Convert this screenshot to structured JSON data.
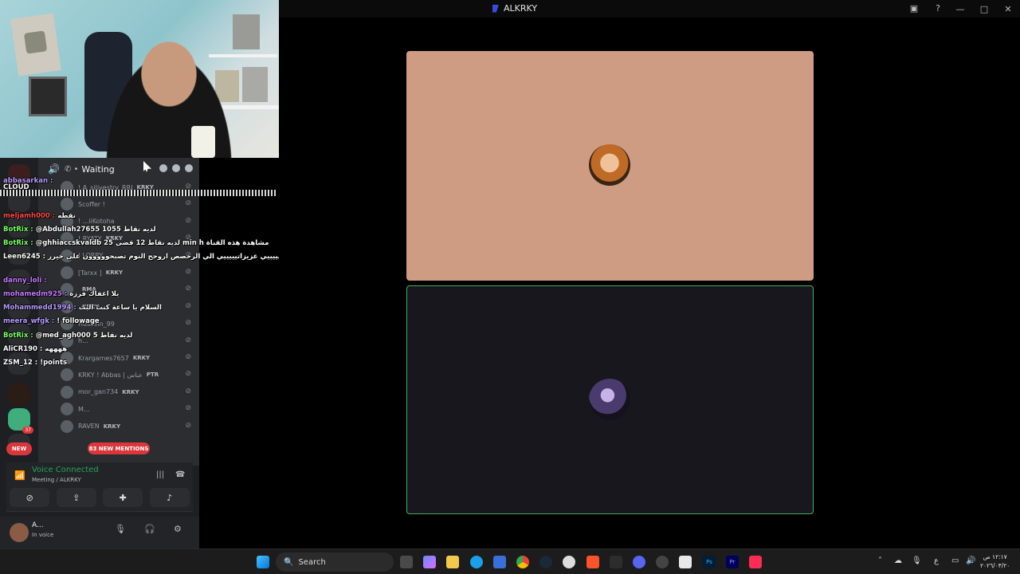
{
  "window": {
    "title": "ALKRKY",
    "controls": [
      "—",
      "□",
      "✕"
    ]
  },
  "channel_header": {
    "status": "Waiting"
  },
  "members": [
    {
      "name": "! A_silivestry_RRI",
      "tag": "KRKY"
    },
    {
      "name": "Scoffer !",
      "tag": ""
    },
    {
      "name": "! ...iiKotoha",
      "tag": ""
    },
    {
      "name": "! RYATY",
      "tag": "KRKY"
    },
    {
      "name": "| LORRY",
      "tag": ""
    },
    {
      "name": "[Tarxx ]",
      "tag": "KRKY"
    },
    {
      "name": "",
      "tag": "RMA"
    },
    {
      "name": "",
      "tag": "KRKY"
    },
    {
      "name": "Hussein_99",
      "tag": ""
    },
    {
      "name": "h...",
      "tag": ""
    },
    {
      "name": "Krargames7657",
      "tag": "KRKY"
    },
    {
      "name": "KRKY ! Abbas | عباس",
      "tag": "PTR"
    },
    {
      "name": "mor_gan734",
      "tag": "KRKY"
    },
    {
      "name": "M...",
      "tag": ""
    },
    {
      "name": "RAVEN",
      "tag": "KRKY"
    }
  ],
  "chat": [
    {
      "user": "abbasarkan :",
      "text": "",
      "color": "#b89cff"
    },
    {
      "user": "CLOUD",
      "text": "",
      "color": "#ffffff"
    },
    {
      "user": "meljamh000 :",
      "text": "نقطه",
      "color": "#ff4b4b"
    },
    {
      "user": "BotRix :",
      "text": "@Abdullah27655 لديه نقاط 1055",
      "color": "#7dff6b"
    },
    {
      "user": "BotRix :",
      "text": "@ghhiaccskvaldb لديه نقاط 12 قضى 25 min h مشاهدة هذه القناة",
      "color": "#7dff6b"
    },
    {
      "user": "Leen6245 :",
      "text": "يلا اعزائيييييي عزيزاتيييييي الي الرخصص اروحح النوم تصبحووووون على خيرر ❤️",
      "color": "#ffffff"
    },
    {
      "user": "danny_loli :",
      "text": "",
      "color": "#c67cff"
    },
    {
      "user": "mohamedm925 :",
      "text": "يلا اغفاك فرزة",
      "color": "#c67cff"
    },
    {
      "user": "Mohammedd1994 :",
      "text": "السلام يا ساعة كنت البت",
      "color": "#b89cff"
    },
    {
      "user": "meera_wfgk :",
      "text": "! followage",
      "color": "#b89cff"
    },
    {
      "user": "BotRix :",
      "text": "@med_agh000 لديه نقاط 5",
      "color": "#7dff6b"
    },
    {
      "user": "AliCR190 :",
      "text": "ههههه",
      "color": "#ffffff"
    },
    {
      "user": "ZSM_12 :",
      "text": "!points",
      "color": "#ffffff"
    }
  ],
  "badges": {
    "new": "NEW",
    "mentions": "83 NEW MENTIONS",
    "guild_count": "37"
  },
  "voice": {
    "status": "Voice Connected",
    "channel": "Meeting / ALKRKY"
  },
  "user": {
    "name": "A...",
    "status": "In voice"
  },
  "taskbar": {
    "search_placeholder": "Search",
    "lang": "ع",
    "time": "١٢:١٧ ص",
    "date": "٢٠٢٦/٠٣/٢٠"
  },
  "colors": {
    "tile1_bg": "#cd9c82",
    "tile2_border": "#42b35a",
    "discord_bg": "#2b2d31",
    "mention_red": "#da373c"
  }
}
